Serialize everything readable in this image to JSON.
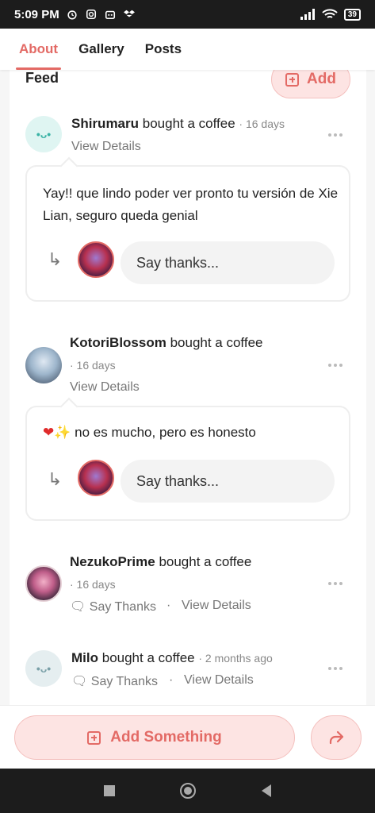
{
  "status_bar": {
    "time": "5:09 PM",
    "battery": "39"
  },
  "tabs": [
    {
      "label": "About",
      "active": true
    },
    {
      "label": "Gallery",
      "active": false
    },
    {
      "label": "Posts",
      "active": false
    }
  ],
  "feed": {
    "title": "Feed",
    "add_label": "Add",
    "items": [
      {
        "name": "Shirumaru",
        "action": "bought a coffee",
        "time": "· 16 days",
        "view_details": "View Details",
        "avatar_emoji": "•ᴗ•",
        "message": "Yay!! que lindo poder ver pronto tu versión de Xie Lian, seguro queda genial",
        "thanks_placeholder": "Say thanks..."
      },
      {
        "name": "KotoriBlossom",
        "action": "bought a coffee",
        "time": "· 16 days",
        "view_details": "View Details",
        "message": "no es mucho, pero es honesto",
        "thanks_placeholder": "Say thanks..."
      },
      {
        "name": "NezukoPrime",
        "action": "bought a coffee",
        "time": "· 16 days",
        "say_thanks": "Say Thanks",
        "separator": "·",
        "view_details": "View Details"
      },
      {
        "name": "Milo",
        "action": "bought a coffee",
        "time": "· 2 months ago",
        "avatar_emoji": "•ᴗ•",
        "say_thanks": "Say Thanks",
        "separator": "·",
        "view_details": "View Details"
      }
    ]
  },
  "bottom": {
    "add_something_label": "Add Something"
  },
  "colors": {
    "accent": "#e36a65",
    "accent_bg": "#fde4e3"
  }
}
